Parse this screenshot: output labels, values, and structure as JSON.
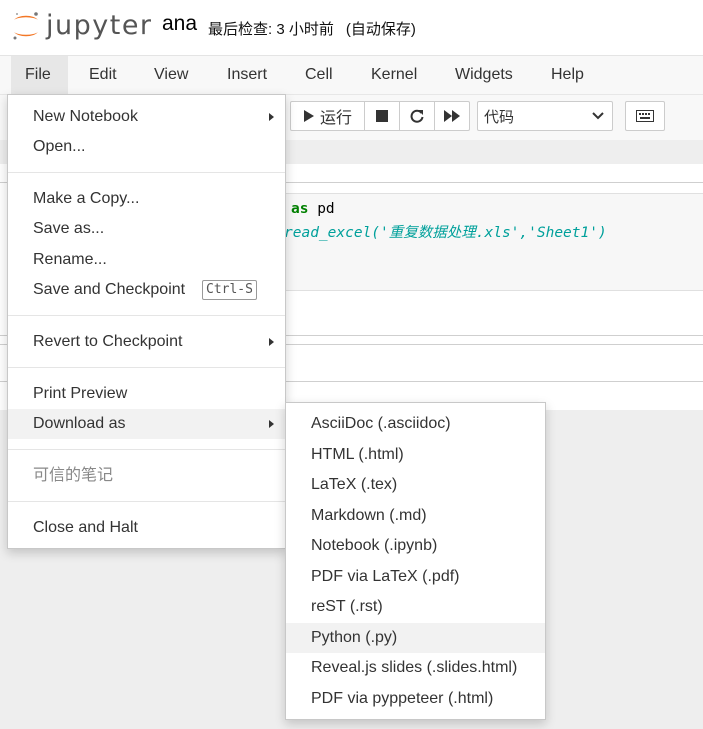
{
  "header": {
    "logo_text": "jupyter",
    "notebook_name": "ana",
    "checkpoint_text": "最后检查: 3 小时前",
    "autosave_text": "(自动保存)"
  },
  "menubar": {
    "items": [
      "File",
      "Edit",
      "View",
      "Insert",
      "Cell",
      "Kernel",
      "Widgets",
      "Help"
    ]
  },
  "toolbar": {
    "run_label": "运行",
    "cell_type_selected": "代码"
  },
  "code": {
    "line1_keyword": "as",
    "line1_name": "pd",
    "line2": "read_excel('重复数据处理.xls','Sheet1')"
  },
  "file_menu": {
    "items": [
      "New Notebook",
      "Open...",
      "Make a Copy...",
      "Save as...",
      "Rename...",
      "Save and Checkpoint",
      "Revert to Checkpoint",
      "Print Preview",
      "Download as",
      "可信的笔记",
      "Close and Halt"
    ],
    "save_checkpoint_shortcut": "Ctrl-S"
  },
  "download_submenu": {
    "items": [
      "AsciiDoc (.asciidoc)",
      "HTML (.html)",
      "LaTeX (.tex)",
      "Markdown (.md)",
      "Notebook (.ipynb)",
      "PDF via LaTeX (.pdf)",
      "reST (.rst)",
      "Python (.py)",
      "Reveal.js slides (.slides.html)",
      "PDF via pyppeteer (.html)"
    ]
  },
  "colors": {
    "logo_orange": "#f37726",
    "code_italic": "#00a09b",
    "keyword": "#008000"
  }
}
